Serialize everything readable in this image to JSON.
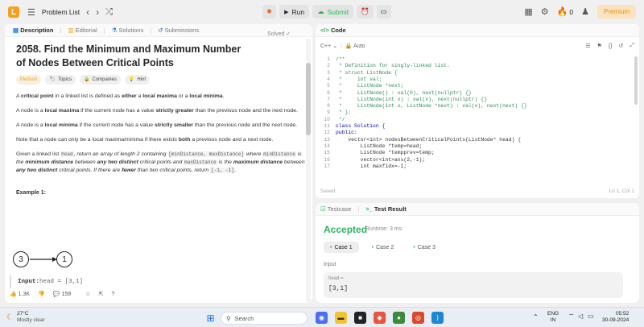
{
  "topbar": {
    "problem_list": "Problem List",
    "run": "Run",
    "submit": "Submit",
    "streak": "0",
    "premium": "Premium"
  },
  "left_tabs": [
    "Description",
    "Editorial",
    "Solutions",
    "Submissions"
  ],
  "problem": {
    "title": "2058. Find the Minimum and Maximum Number of Nodes Between Critical Points",
    "solved": "Solved",
    "difficulty": "Medium",
    "topics": "Topics",
    "companies": "Companies",
    "hint": "Hint",
    "p1_a": "A ",
    "p1_b": "critical point",
    "p1_c": " in a linked list is defined as ",
    "p1_d": "either",
    "p1_e": " a ",
    "p1_f": "local maxima",
    "p1_g": " or a ",
    "p1_h": "local minima",
    "p1_i": ".",
    "p2_a": "A node is a ",
    "p2_b": "local maxima",
    "p2_c": " if the current node has a value ",
    "p2_d": "strictly greater",
    "p2_e": " than the previous node and the next node.",
    "p3_a": "A node is a ",
    "p3_b": "local minima",
    "p3_c": " if the current node has a value ",
    "p3_d": "strictly smaller",
    "p3_e": " than the previous node and the next node.",
    "p4_a": "Note that a node can only be a local maxima/minima if there exists ",
    "p4_b": "both",
    "p4_c": " a previous node and a next node.",
    "p5_a": "Given a linked list ",
    "p5_head": "head",
    "p5_b": ", return an array of length 2 containing ",
    "p5_arr": "[minDistance, maxDistance]",
    "p5_c": " where ",
    "p5_min": "minDistance",
    "p5_d": " is the ",
    "p5_e": "minimum distance",
    "p5_f": " between ",
    "p5_g": "any two distinct",
    "p5_h": " critical points and ",
    "p5_max": "maxDistance",
    "p5_i": " is the ",
    "p5_j": "maximum distance",
    "p5_k": " between ",
    "p5_l": "any two distinct",
    "p5_m": " critical points. If there are ",
    "p5_n": "fewer",
    "p5_o": " than two critical points, return ",
    "p5_ret": "[-1, -1]",
    "p5_p": ".",
    "example_title": "Example 1:",
    "node_a": "3",
    "node_b": "1",
    "input_label": "Input:",
    "input_value": " head = [3,1]"
  },
  "footer": {
    "likes": "1.3K",
    "comments": "159"
  },
  "code_panel": {
    "title": "Code",
    "language": "C++",
    "auto": "Auto",
    "saved": "Saved",
    "position": "Ln 1, Col 1",
    "lines": [
      "/**",
      " * Definition for singly-linked list.",
      " * struct ListNode {",
      " *     int val;",
      " *     ListNode *next;",
      " *     ListNode() : val(0), next(nullptr) {}",
      " *     ListNode(int x) : val(x), next(nullptr) {}",
      " *     ListNode(int x, ListNode *next) : val(x), next(next) {}",
      " * };",
      " */",
      "class Solution {",
      "public:",
      "    vector<int> nodesBetweenCriticalPoints(ListNode* head) {",
      "        ListNode *temp=head;",
      "        ListNode *tempprev=temp;",
      "        vector<int>ans(2,-1);",
      "        int maxfidx=-1;"
    ]
  },
  "result_panel": {
    "testcase_tab": "Testcase",
    "result_tab": "Test Result",
    "status": "Accepted",
    "runtime": "Runtime: 3 ms",
    "cases": [
      "Case 1",
      "Case 2",
      "Case 3"
    ],
    "input_label": "Input",
    "var_name": "head =",
    "var_value": "[3,1]"
  },
  "taskbar": {
    "temp": "27°C",
    "weather": "Mostly clear",
    "search": "Search",
    "lang1": "ENG",
    "lang2": "IN",
    "time": "05:52",
    "date": "30-09-2024"
  }
}
